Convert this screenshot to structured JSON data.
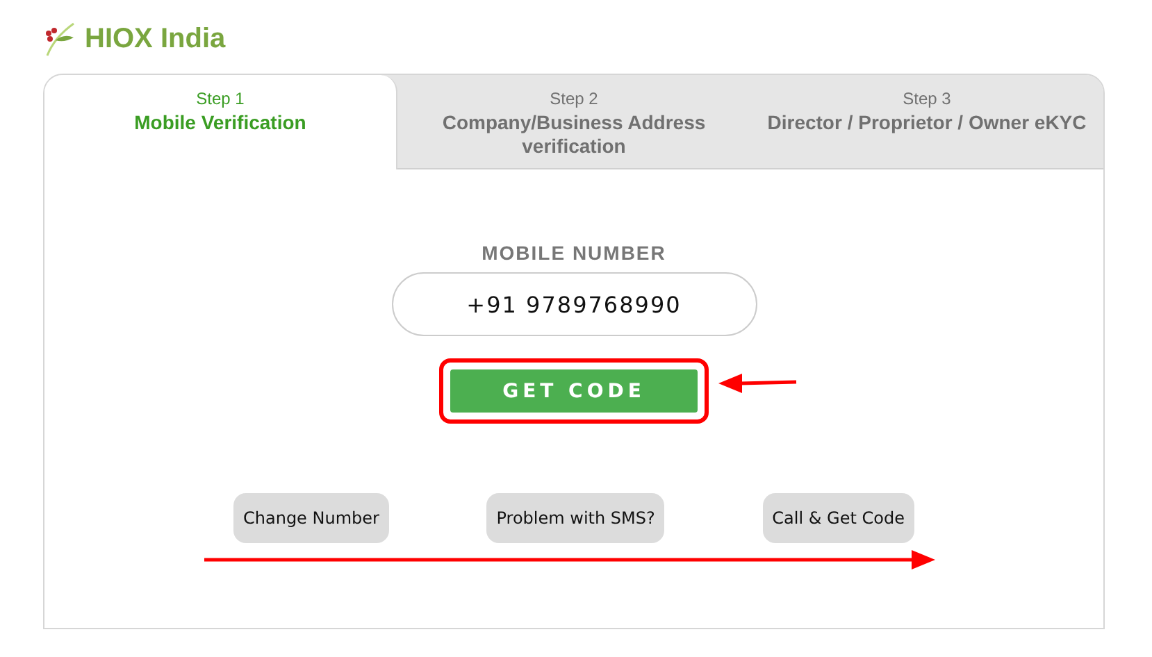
{
  "brand": {
    "name": "HIOX India"
  },
  "tabs": [
    {
      "step": "Step 1",
      "label": "Mobile Verification",
      "selected": true
    },
    {
      "step": "Step 2",
      "label": "Company/Business Address verification",
      "selected": false
    },
    {
      "step": "Step 3",
      "label": "Director / Proprietor / Owner eKYC",
      "selected": false
    }
  ],
  "mobile": {
    "label": "MOBILE NUMBER",
    "value": "+91 9789768990"
  },
  "primary_button": {
    "label": "GET CODE",
    "highlighted": true
  },
  "secondary_buttons": [
    "Change Number",
    "Problem with SMS?",
    "Call & Get Code"
  ]
}
